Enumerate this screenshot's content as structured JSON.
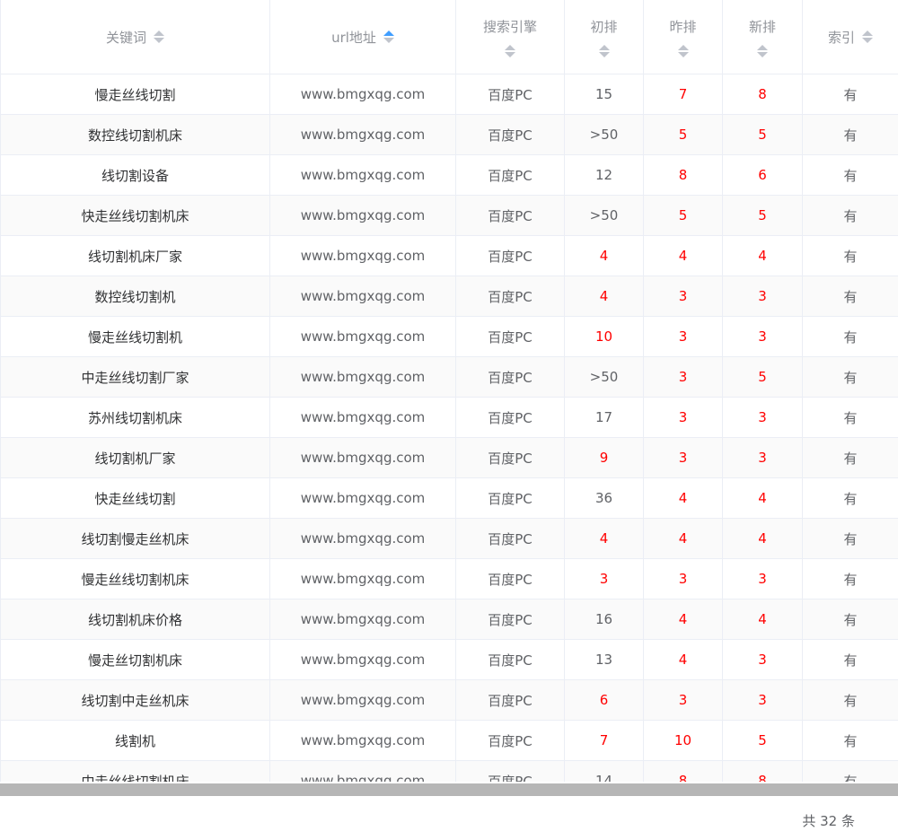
{
  "columns": {
    "keyword": "关键词",
    "url": "url地址",
    "engine": "搜索引擎",
    "initial": "初排",
    "yesterday": "昨排",
    "new": "新排",
    "index": "索引"
  },
  "rows": [
    {
      "keyword": "慢走丝线切割",
      "url": "www.bmgxqg.com",
      "engine": "百度PC",
      "initial": "15",
      "yesterday": "7",
      "new": "8",
      "index": "有",
      "initial_red": false
    },
    {
      "keyword": "数控线切割机床",
      "url": "www.bmgxqg.com",
      "engine": "百度PC",
      "initial": ">50",
      "yesterday": "5",
      "new": "5",
      "index": "有",
      "initial_red": false
    },
    {
      "keyword": "线切割设备",
      "url": "www.bmgxqg.com",
      "engine": "百度PC",
      "initial": "12",
      "yesterday": "8",
      "new": "6",
      "index": "有",
      "initial_red": false
    },
    {
      "keyword": "快走丝线切割机床",
      "url": "www.bmgxqg.com",
      "engine": "百度PC",
      "initial": ">50",
      "yesterday": "5",
      "new": "5",
      "index": "有",
      "initial_red": false
    },
    {
      "keyword": "线切割机床厂家",
      "url": "www.bmgxqg.com",
      "engine": "百度PC",
      "initial": "4",
      "yesterday": "4",
      "new": "4",
      "index": "有",
      "initial_red": true
    },
    {
      "keyword": "数控线切割机",
      "url": "www.bmgxqg.com",
      "engine": "百度PC",
      "initial": "4",
      "yesterday": "3",
      "new": "3",
      "index": "有",
      "initial_red": true
    },
    {
      "keyword": "慢走丝线切割机",
      "url": "www.bmgxqg.com",
      "engine": "百度PC",
      "initial": "10",
      "yesterday": "3",
      "new": "3",
      "index": "有",
      "initial_red": true
    },
    {
      "keyword": "中走丝线切割厂家",
      "url": "www.bmgxqg.com",
      "engine": "百度PC",
      "initial": ">50",
      "yesterday": "3",
      "new": "5",
      "index": "有",
      "initial_red": false
    },
    {
      "keyword": "苏州线切割机床",
      "url": "www.bmgxqg.com",
      "engine": "百度PC",
      "initial": "17",
      "yesterday": "3",
      "new": "3",
      "index": "有",
      "initial_red": false
    },
    {
      "keyword": "线切割机厂家",
      "url": "www.bmgxqg.com",
      "engine": "百度PC",
      "initial": "9",
      "yesterday": "3",
      "new": "3",
      "index": "有",
      "initial_red": true
    },
    {
      "keyword": "快走丝线切割",
      "url": "www.bmgxqg.com",
      "engine": "百度PC",
      "initial": "36",
      "yesterday": "4",
      "new": "4",
      "index": "有",
      "initial_red": false
    },
    {
      "keyword": "线切割慢走丝机床",
      "url": "www.bmgxqg.com",
      "engine": "百度PC",
      "initial": "4",
      "yesterday": "4",
      "new": "4",
      "index": "有",
      "initial_red": true
    },
    {
      "keyword": "慢走丝线切割机床",
      "url": "www.bmgxqg.com",
      "engine": "百度PC",
      "initial": "3",
      "yesterday": "3",
      "new": "3",
      "index": "有",
      "initial_red": true
    },
    {
      "keyword": "线切割机床价格",
      "url": "www.bmgxqg.com",
      "engine": "百度PC",
      "initial": "16",
      "yesterday": "4",
      "new": "4",
      "index": "有",
      "initial_red": false
    },
    {
      "keyword": "慢走丝切割机床",
      "url": "www.bmgxqg.com",
      "engine": "百度PC",
      "initial": "13",
      "yesterday": "4",
      "new": "3",
      "index": "有",
      "initial_red": false
    },
    {
      "keyword": "线切割中走丝机床",
      "url": "www.bmgxqg.com",
      "engine": "百度PC",
      "initial": "6",
      "yesterday": "3",
      "new": "3",
      "index": "有",
      "initial_red": true
    },
    {
      "keyword": "线割机",
      "url": "www.bmgxqg.com",
      "engine": "百度PC",
      "initial": "7",
      "yesterday": "10",
      "new": "5",
      "index": "有",
      "initial_red": true
    },
    {
      "keyword": "中走丝线切割机床",
      "url": "www.bmgxqg.com",
      "engine": "百度PC",
      "initial": "14",
      "yesterday": "8",
      "new": "8",
      "index": "有",
      "initial_red": false
    }
  ],
  "footer": {
    "total": "共 32 条"
  },
  "colors": {
    "rank_highlight": "#ff0000",
    "sort_active": "#409eff",
    "sort_inactive": "#c0c4cc"
  }
}
